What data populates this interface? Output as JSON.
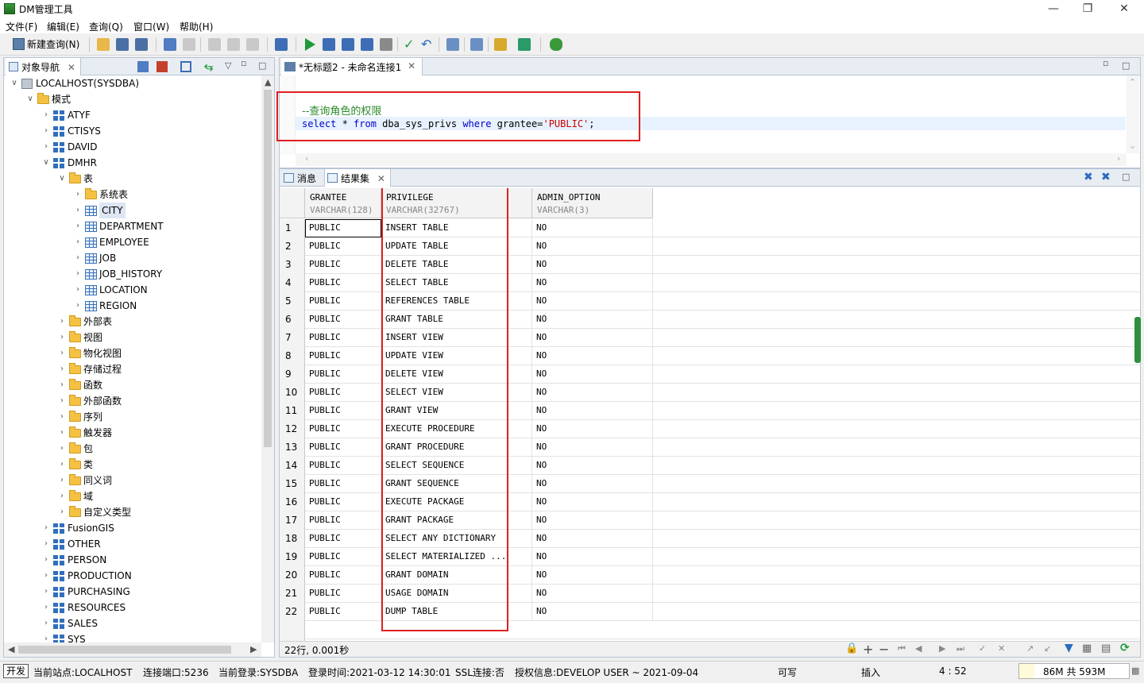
{
  "window": {
    "title": "DM管理工具"
  },
  "menu": [
    "文件(F)",
    "编辑(E)",
    "查询(Q)",
    "窗口(W)",
    "帮助(H)"
  ],
  "toolbar": {
    "new_query_label": "新建查询(N)"
  },
  "left_panel": {
    "tab_label": "对象导航",
    "tree": [
      {
        "label": "LOCALHOST(SYSDBA)",
        "level": 0,
        "icon": "server-icon",
        "state": "expanded"
      },
      {
        "label": "模式",
        "level": 1,
        "icon": "folder-icon",
        "state": "expanded"
      },
      {
        "label": "ATYF",
        "level": 2,
        "icon": "schema-icon",
        "state": "collapsed"
      },
      {
        "label": "CTISYS",
        "level": 2,
        "icon": "schema-icon",
        "state": "collapsed"
      },
      {
        "label": "DAVID",
        "level": 2,
        "icon": "schema-icon",
        "state": "collapsed"
      },
      {
        "label": "DMHR",
        "level": 2,
        "icon": "schema-icon",
        "state": "expanded"
      },
      {
        "label": "表",
        "level": 3,
        "icon": "folder-icon",
        "state": "expanded"
      },
      {
        "label": "系统表",
        "level": 4,
        "icon": "folder-icon",
        "state": "collapsed"
      },
      {
        "label": "CITY",
        "level": 4,
        "icon": "table-icon",
        "state": "collapsed",
        "selected": true
      },
      {
        "label": "DEPARTMENT",
        "level": 4,
        "icon": "table-icon",
        "state": "collapsed"
      },
      {
        "label": "EMPLOYEE",
        "level": 4,
        "icon": "table-icon",
        "state": "collapsed"
      },
      {
        "label": "JOB",
        "level": 4,
        "icon": "table-icon",
        "state": "collapsed"
      },
      {
        "label": "JOB_HISTORY",
        "level": 4,
        "icon": "table-icon",
        "state": "collapsed"
      },
      {
        "label": "LOCATION",
        "level": 4,
        "icon": "table-icon",
        "state": "collapsed"
      },
      {
        "label": "REGION",
        "level": 4,
        "icon": "table-icon",
        "state": "collapsed"
      },
      {
        "label": "外部表",
        "level": 3,
        "icon": "folder-icon",
        "state": "collapsed"
      },
      {
        "label": "视图",
        "level": 3,
        "icon": "folder-icon",
        "state": "collapsed"
      },
      {
        "label": "物化视图",
        "level": 3,
        "icon": "folder-icon",
        "state": "collapsed"
      },
      {
        "label": "存储过程",
        "level": 3,
        "icon": "folder-icon",
        "state": "collapsed"
      },
      {
        "label": "函数",
        "level": 3,
        "icon": "folder-icon",
        "state": "collapsed"
      },
      {
        "label": "外部函数",
        "level": 3,
        "icon": "folder-icon",
        "state": "collapsed"
      },
      {
        "label": "序列",
        "level": 3,
        "icon": "folder-icon",
        "state": "collapsed"
      },
      {
        "label": "触发器",
        "level": 3,
        "icon": "folder-icon",
        "state": "collapsed"
      },
      {
        "label": "包",
        "level": 3,
        "icon": "folder-icon",
        "state": "collapsed"
      },
      {
        "label": "类",
        "level": 3,
        "icon": "folder-icon",
        "state": "collapsed"
      },
      {
        "label": "同义词",
        "level": 3,
        "icon": "folder-icon",
        "state": "collapsed"
      },
      {
        "label": "域",
        "level": 3,
        "icon": "folder-icon",
        "state": "collapsed"
      },
      {
        "label": "自定义类型",
        "level": 3,
        "icon": "folder-icon",
        "state": "collapsed"
      },
      {
        "label": "FusionGIS",
        "level": 2,
        "icon": "schema-icon",
        "state": "collapsed"
      },
      {
        "label": "OTHER",
        "level": 2,
        "icon": "schema-icon",
        "state": "collapsed"
      },
      {
        "label": "PERSON",
        "level": 2,
        "icon": "schema-icon",
        "state": "collapsed"
      },
      {
        "label": "PRODUCTION",
        "level": 2,
        "icon": "schema-icon",
        "state": "collapsed"
      },
      {
        "label": "PURCHASING",
        "level": 2,
        "icon": "schema-icon",
        "state": "collapsed"
      },
      {
        "label": "RESOURCES",
        "level": 2,
        "icon": "schema-icon",
        "state": "collapsed"
      },
      {
        "label": "SALES",
        "level": 2,
        "icon": "schema-icon",
        "state": "collapsed"
      },
      {
        "label": "SYS",
        "level": 2,
        "icon": "schema-icon",
        "state": "collapsed"
      }
    ]
  },
  "editor": {
    "tab_label": "*无标题2 - 未命名连接1",
    "comment": "--查询角色的权限",
    "sql": {
      "kw1": "select",
      "star": " * ",
      "kw2": "from",
      "table": " dba_sys_privs ",
      "kw3": "where",
      "cond": " grantee=",
      "value": "'PUBLIC'",
      "end": ";"
    }
  },
  "results": {
    "tab_messages": "消息",
    "tab_resultset": "结果集",
    "columns": [
      {
        "name": "GRANTEE",
        "type": "VARCHAR(128)"
      },
      {
        "name": "PRIVILEGE",
        "type": "VARCHAR(32767)"
      },
      {
        "name": "ADMIN_OPTION",
        "type": "VARCHAR(3)"
      }
    ],
    "rows": [
      [
        "1",
        "PUBLIC",
        "INSERT TABLE",
        "NO"
      ],
      [
        "2",
        "PUBLIC",
        "UPDATE TABLE",
        "NO"
      ],
      [
        "3",
        "PUBLIC",
        "DELETE TABLE",
        "NO"
      ],
      [
        "4",
        "PUBLIC",
        "SELECT TABLE",
        "NO"
      ],
      [
        "5",
        "PUBLIC",
        "REFERENCES TABLE",
        "NO"
      ],
      [
        "6",
        "PUBLIC",
        "GRANT TABLE",
        "NO"
      ],
      [
        "7",
        "PUBLIC",
        "INSERT VIEW",
        "NO"
      ],
      [
        "8",
        "PUBLIC",
        "UPDATE VIEW",
        "NO"
      ],
      [
        "9",
        "PUBLIC",
        "DELETE VIEW",
        "NO"
      ],
      [
        "10",
        "PUBLIC",
        "SELECT VIEW",
        "NO"
      ],
      [
        "11",
        "PUBLIC",
        "GRANT VIEW",
        "NO"
      ],
      [
        "12",
        "PUBLIC",
        "EXECUTE PROCEDURE",
        "NO"
      ],
      [
        "13",
        "PUBLIC",
        "GRANT PROCEDURE",
        "NO"
      ],
      [
        "14",
        "PUBLIC",
        "SELECT SEQUENCE",
        "NO"
      ],
      [
        "15",
        "PUBLIC",
        "GRANT SEQUENCE",
        "NO"
      ],
      [
        "16",
        "PUBLIC",
        "EXECUTE PACKAGE",
        "NO"
      ],
      [
        "17",
        "PUBLIC",
        "GRANT PACKAGE",
        "NO"
      ],
      [
        "18",
        "PUBLIC",
        "SELECT ANY DICTIONARY",
        "NO"
      ],
      [
        "19",
        "PUBLIC",
        "SELECT MATERIALIZED ...",
        "NO"
      ],
      [
        "20",
        "PUBLIC",
        "GRANT DOMAIN",
        "NO"
      ],
      [
        "21",
        "PUBLIC",
        "USAGE DOMAIN",
        "NO"
      ],
      [
        "22",
        "PUBLIC",
        "DUMP TABLE",
        "NO"
      ]
    ],
    "summary": "22行, 0.001秒"
  },
  "statusbar": {
    "mode": "开发",
    "site": "当前站点:LOCALHOST",
    "port": "连接端口:5236",
    "login": "当前登录:SYSDBA",
    "login_time": "登录时间:2021-03-12 14:30:01",
    "ssl": "SSL连接:否",
    "license": "授权信息:DEVELOP USER ~ 2021-09-04",
    "writable": "可写",
    "insert": "插入",
    "cursor": "4 : 52",
    "memory": "86M 共 593M",
    "memory_used_fraction": 0.145
  },
  "colors": {
    "highlight": "#e02020",
    "keyword": "#0000cc",
    "string": "#c80000",
    "comment": "#2a8a2a"
  }
}
